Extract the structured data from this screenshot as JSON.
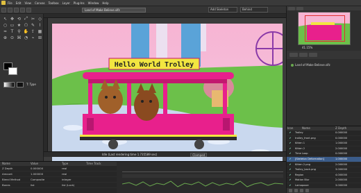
{
  "menu": [
    "File",
    "Edit",
    "View",
    "Canvas",
    "Toolbox",
    "Layer",
    "Plug-Ins",
    "Window",
    "Help"
  ],
  "document_tab": "Land of Make Believe.sifz",
  "right_toolbar": {
    "mode": "Add Skeleton",
    "blend": "Behind"
  },
  "toolbox": {
    "tools": [
      "↖",
      "✥",
      "⟲",
      "⤢",
      "✂",
      "◇",
      "○",
      "▭",
      "★",
      "⬠",
      "✎",
      "⌇",
      "≈",
      "T",
      "⚲",
      "✋",
      "⇪",
      "▦",
      "⊕",
      "⊙",
      "⌘",
      "◔",
      "⌁",
      "⊞"
    ],
    "text_type": "T: Type"
  },
  "canvas": {
    "sign_text": "Hello World Trolley",
    "status_text": "Idle (Last rendering time 1.735589 sec)",
    "clamped": "Clamped"
  },
  "navigator": {
    "zoom": "41.15%"
  },
  "doc_list": {
    "item": "Land of Make Believe.sifz"
  },
  "layers": {
    "headers": [
      "Icon",
      "Name",
      "Z Depth"
    ],
    "rows": [
      {
        "name": "Trolley",
        "z": "0.000000"
      },
      {
        "name": "trolley_front.png",
        "z": "0.000000"
      },
      {
        "name": "Kitten 1",
        "z": "1.000000"
      },
      {
        "name": "Kitten 2",
        "z": "2.000000"
      },
      {
        "name": "Time Loop",
        "z": "0.000000"
      },
      {
        "name": "[Skeleton Deformation]",
        "z": "1.000000"
      },
      {
        "name": "Kitten 2.png",
        "z": "2.000000"
      },
      {
        "name": "Trolley_back.png",
        "z": "3.000000"
      },
      {
        "name": "Region",
        "z": "4.000000"
      },
      {
        "name": "Motion Blur",
        "z": "2.000000"
      },
      {
        "name": "Lamoposer",
        "z": "3.000000"
      }
    ]
  },
  "params": {
    "headers": [
      "Name",
      "Value",
      "Type",
      "Time Track"
    ],
    "rows": [
      {
        "name": "Z Depth",
        "value": "0.000000",
        "type": "real"
      },
      {
        "name": "Amount",
        "value": "1.000000",
        "type": "real"
      },
      {
        "name": "Blend Method",
        "value": "Composite",
        "type": "integer"
      },
      {
        "name": "Bones",
        "value": "list",
        "type": "list (Lock)"
      }
    ]
  },
  "colors": {
    "trolley_pink": "#e8208c",
    "sky_top": "#f4a6c9",
    "grass": "#6cc04a",
    "sign_yellow": "#f2e640",
    "selected_row": "#3b5c8a"
  }
}
